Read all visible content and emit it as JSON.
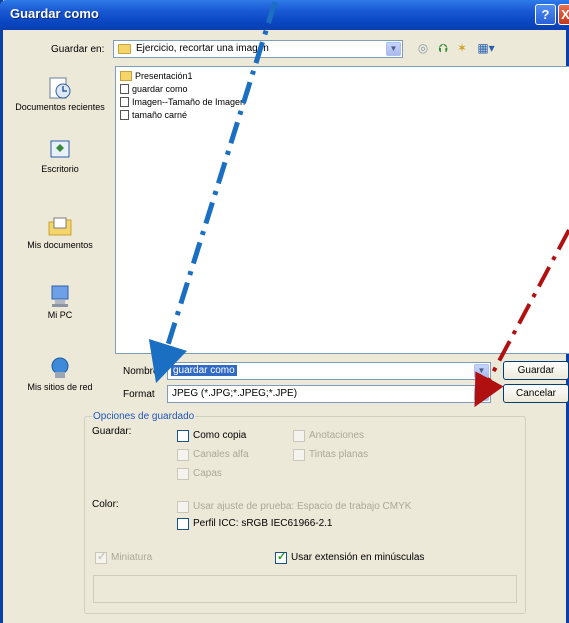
{
  "window": {
    "title": "Guardar como",
    "help_label": "?",
    "close_label": "X"
  },
  "save_in": {
    "label": "Guardar en:",
    "value": "Ejercicio, recortar una imagen"
  },
  "toolbar": {
    "back_icon": "back-arrow-icon",
    "up_icon": "up-folder-icon",
    "new_folder_icon": "new-folder-icon",
    "views_icon": "views-menu-icon"
  },
  "places": [
    {
      "label": "Documentos recientes",
      "icon": "recent-documents-icon"
    },
    {
      "label": "Escritorio",
      "icon": "desktop-icon"
    },
    {
      "label": "Mis documentos",
      "icon": "my-documents-icon"
    },
    {
      "label": "Mi PC",
      "icon": "my-computer-icon"
    },
    {
      "label": "Mis sitios de red",
      "icon": "network-places-icon"
    }
  ],
  "files": [
    {
      "name": "Presentación1",
      "type": "folder"
    },
    {
      "name": "guardar como",
      "type": "file"
    },
    {
      "name": "Imagen--Tamaño de Imagen",
      "type": "file"
    },
    {
      "name": "tamaño carné",
      "type": "file"
    }
  ],
  "filename": {
    "label": "Nombre:",
    "value": "guardar como"
  },
  "format": {
    "label": "Format",
    "value": "JPEG (*.JPG;*.JPEG;*.JPE)"
  },
  "buttons": {
    "save": "Guardar",
    "cancel": "Cancelar"
  },
  "options": {
    "title": "Opciones de guardado",
    "save_label": "Guardar:",
    "como_copia": "Como copia",
    "anotaciones": "Anotaciones",
    "canales_alfa": "Canales alfa",
    "tintas_planas": "Tintas planas",
    "capas": "Capas",
    "color_label": "Color:",
    "usar_ajuste": "Usar ajuste de prueba: Espacio de trabajo CMYK",
    "perfil_icc": "Perfil ICC: sRGB IEC61966-2.1",
    "miniatura": "Miniatura",
    "usar_extension": "Usar extensión en minúsculas"
  },
  "annotations": {
    "blue_arrow_color": "#1a6fc2",
    "red_arrow_color": "#b01010"
  }
}
